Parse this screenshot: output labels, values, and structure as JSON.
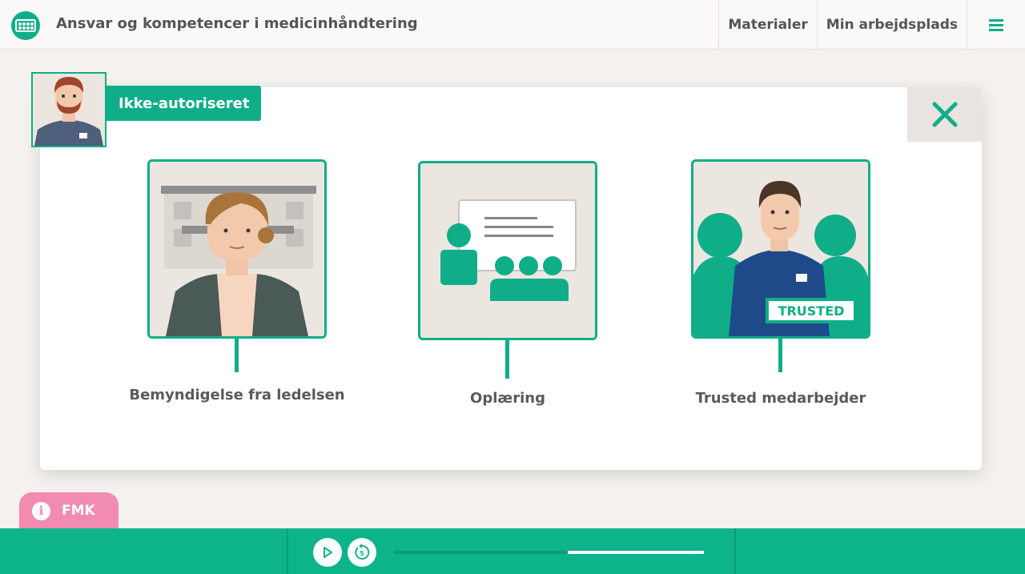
{
  "header": {
    "title": "Ansvar og kompetencer i medicinhåndtering",
    "nav": [
      "Materialer",
      "Min arbejdsplads"
    ],
    "logo_icon": "pill-pack-icon",
    "menu_icon": "hamburger-menu-icon"
  },
  "modal": {
    "role": "Ikke-autoriseret",
    "close_icon": "close-icon",
    "options": [
      {
        "label": "Bemyndigelse fra ledelsen",
        "icon": "manager-portrait"
      },
      {
        "label": "Oplæring",
        "icon": "training-presentation"
      },
      {
        "label": "Trusted medarbejder",
        "icon": "trusted-employee",
        "badge": "TRUSTED"
      }
    ]
  },
  "fmk": {
    "label": "FMK",
    "icon": "info-icon"
  },
  "player": {
    "progress": 0.56,
    "play_icon": "play-icon",
    "replay_icon": "replay-5-icon"
  },
  "colors": {
    "accent": "#0fae88",
    "pink": "#f28bb1",
    "background": "#f4f1ee"
  }
}
